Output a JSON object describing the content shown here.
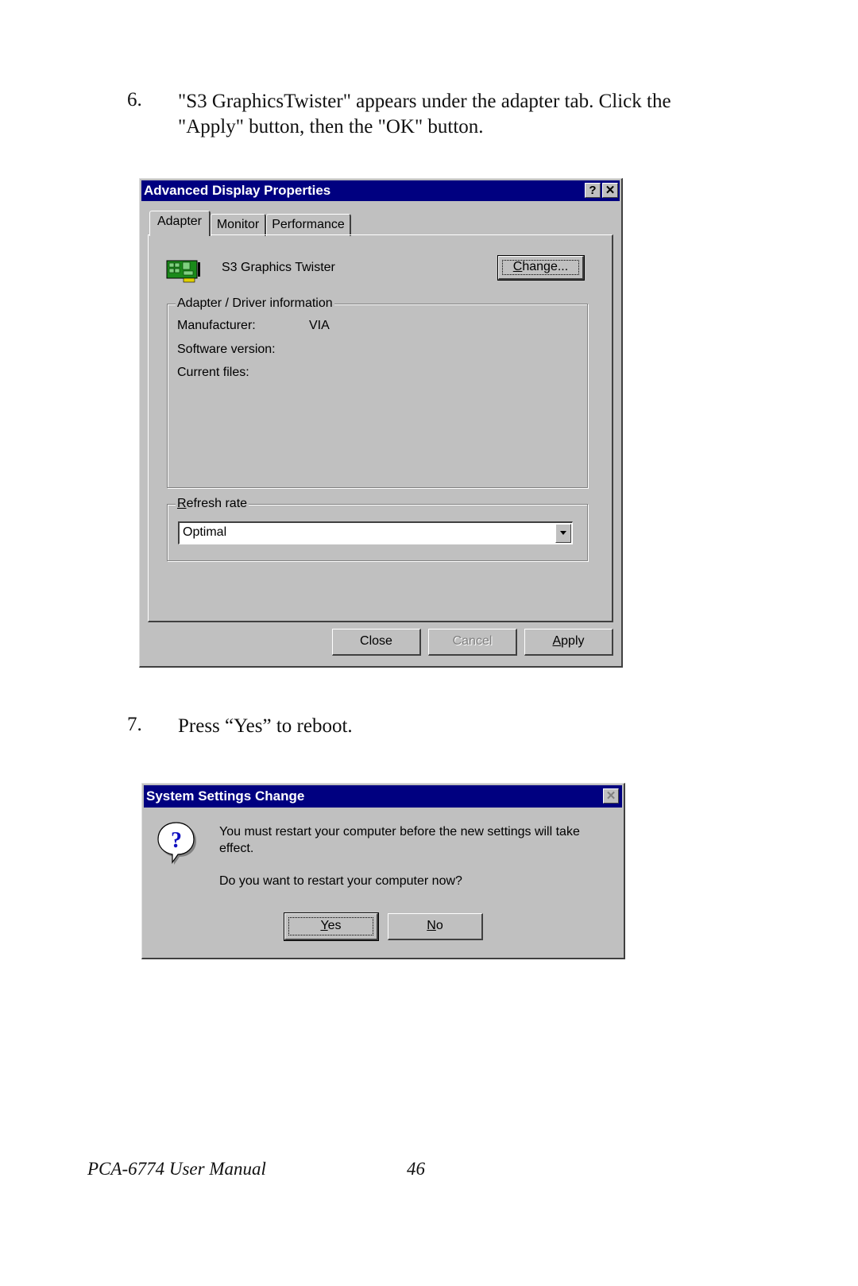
{
  "steps": [
    {
      "number": "6.",
      "lines": [
        "\"S3 GraphicsTwister\" appears under the adapter tab. Click the",
        "\"Apply\" button, then the \"OK\" button."
      ]
    },
    {
      "number": "7.",
      "lines": [
        "Press “Yes” to reboot."
      ]
    }
  ],
  "dialog1": {
    "title": "Advanced Display Properties",
    "help_button": "?",
    "close_button": "✕",
    "tabs": [
      {
        "label": "Adapter",
        "active": true
      },
      {
        "label": "Monitor",
        "active": false
      },
      {
        "label": "Performance",
        "active": false
      }
    ],
    "adapter_icon": "display-adapter-card-icon",
    "adapter_name": "S3 Graphics Twister",
    "change_button": {
      "prefix": "",
      "mnemonic": "C",
      "rest": "hange..."
    },
    "driver_group": {
      "label": "Adapter / Driver information",
      "rows": [
        {
          "label": "Manufacturer:",
          "value": "VIA"
        },
        {
          "label": "Software version:",
          "value": ""
        },
        {
          "label": "Current files:",
          "value": ""
        }
      ]
    },
    "refresh_group": {
      "label_mnemonic": "R",
      "label_rest": "efresh rate",
      "selected": "Optimal"
    },
    "buttons": {
      "close": "Close",
      "cancel": "Cancel",
      "apply_mnemonic": "A",
      "apply_rest": "pply"
    }
  },
  "dialog2": {
    "title": "System Settings Change",
    "close_button": "✕",
    "icon": "question-icon",
    "message_line1": "You must restart your computer before the new settings will take",
    "message_line2": "effect.",
    "question": "Do you want to restart your computer now?",
    "yes_mnemonic": "Y",
    "yes_rest": "es",
    "no_mnemonic": "N",
    "no_rest": "o"
  },
  "footer": {
    "manual_title": "PCA-6774 User Manual",
    "page_number": "46"
  }
}
